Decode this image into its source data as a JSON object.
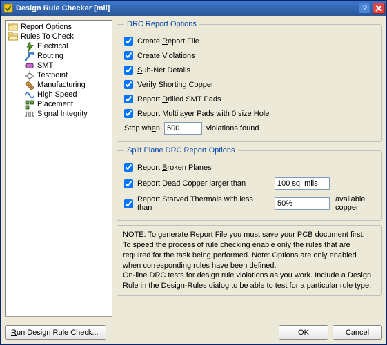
{
  "window": {
    "title": "Design Rule Checker [mil]"
  },
  "tree": {
    "root1": "Report Options",
    "root2": "Rules To Check",
    "items": [
      "Electrical",
      "Routing",
      "SMT",
      "Testpoint",
      "Manufacturing",
      "High Speed",
      "Placement",
      "Signal Integrity"
    ]
  },
  "drc": {
    "legend": "DRC Report Options",
    "create_report": "Create Report File",
    "create_violations": "Create Violations",
    "subnet": "Sub-Net Details",
    "verify_short": "Verify Shorting Copper",
    "drilled_smt": "Report Drilled SMT Pads",
    "multilayer": "Report Multilayer Pads with 0 size Hole",
    "stop_left": "Stop when",
    "stop_value": "500",
    "stop_right": "violations found"
  },
  "split": {
    "legend": "Split Plane DRC Report Options",
    "broken": "Report Broken Planes",
    "dead_label": "Report Dead Copper larger than",
    "dead_value": "100 sq. mils",
    "starved_label": "Report Starved Thermals with less than",
    "starved_value": "50%",
    "starved_suffix": "available copper"
  },
  "note": {
    "line1": "NOTE: To generate Report File you must save your PCB document first.",
    "line2": "To speed the process of rule checking enable only the rules that are required for the task being performed.  Note: Options are only enabled when corresponding rules have been defined.",
    "line3": "On-line DRC tests for design rule violations as you work. Include a Design Rule in the Design-Rules dialog to be able to test for a particular rule  type."
  },
  "buttons": {
    "run": "Run Design Rule Check...",
    "ok": "OK",
    "cancel": "Cancel"
  }
}
